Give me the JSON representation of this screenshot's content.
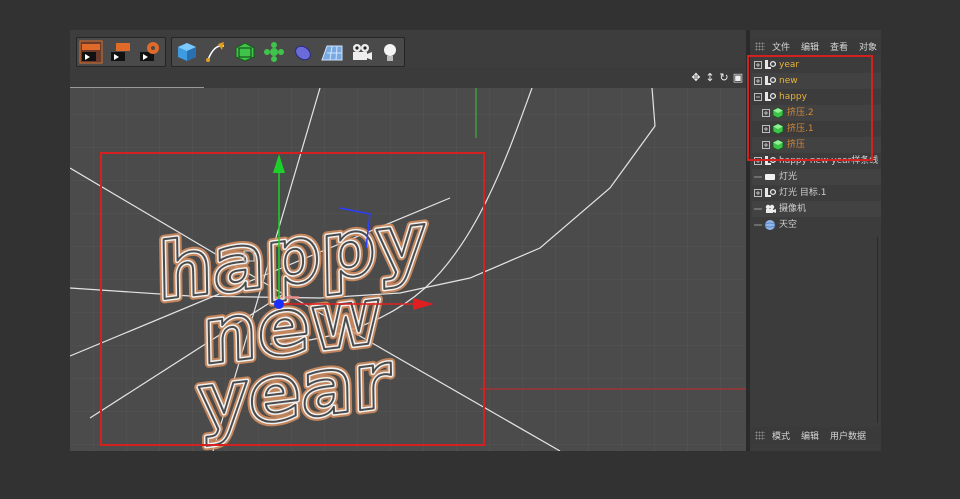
{
  "toolbar": {
    "buttons": [
      "render-view-icon",
      "render-picture-viewer-icon",
      "render-settings-icon",
      "cube-icon",
      "pen-spline-icon",
      "subdivision-icon",
      "array-icon",
      "deformer-icon",
      "floor-icon",
      "camera-icon",
      "light-icon"
    ]
  },
  "object_manager": {
    "menu": [
      "文件",
      "编辑",
      "查看",
      "对象"
    ],
    "items": [
      {
        "label": "year",
        "color": "#e8b23a",
        "indent": 0,
        "type": "null"
      },
      {
        "label": "new",
        "color": "#e8b23a",
        "indent": 0,
        "type": "null"
      },
      {
        "label": "happy",
        "color": "#e8b23a",
        "indent": 0,
        "type": "null",
        "expanded": true
      },
      {
        "label": "挤压.2",
        "color": "#d48a35",
        "indent": 1,
        "type": "extrude"
      },
      {
        "label": "挤压.1",
        "color": "#d48a35",
        "indent": 1,
        "type": "extrude"
      },
      {
        "label": "挤压",
        "color": "#d48a35",
        "indent": 1,
        "type": "extrude"
      },
      {
        "label": "happy new year样条线",
        "color": "#cfcfcf",
        "indent": 0,
        "type": "null"
      },
      {
        "label": "灯光",
        "color": "#cfcfcf",
        "indent": 0,
        "type": "light"
      },
      {
        "label": "灯光 目标.1",
        "color": "#cfcfcf",
        "indent": 0,
        "type": "null"
      },
      {
        "label": "摄像机",
        "color": "#cfcfcf",
        "indent": 0,
        "type": "camera"
      },
      {
        "label": "天空",
        "color": "#cfcfcf",
        "indent": 0,
        "type": "sky"
      }
    ]
  },
  "attribute_manager": {
    "menu": [
      "模式",
      "编辑",
      "用户数据"
    ]
  },
  "viewport": {
    "text_lines": [
      "happy",
      "new",
      "year"
    ]
  },
  "colors": {
    "highlight_box": "#d52020",
    "axis_x": "#e02020",
    "axis_y": "#1ccf2a",
    "axis_z": "#1a2fff",
    "text_glow": "#e0a070",
    "active_label": "#e8b23a"
  }
}
